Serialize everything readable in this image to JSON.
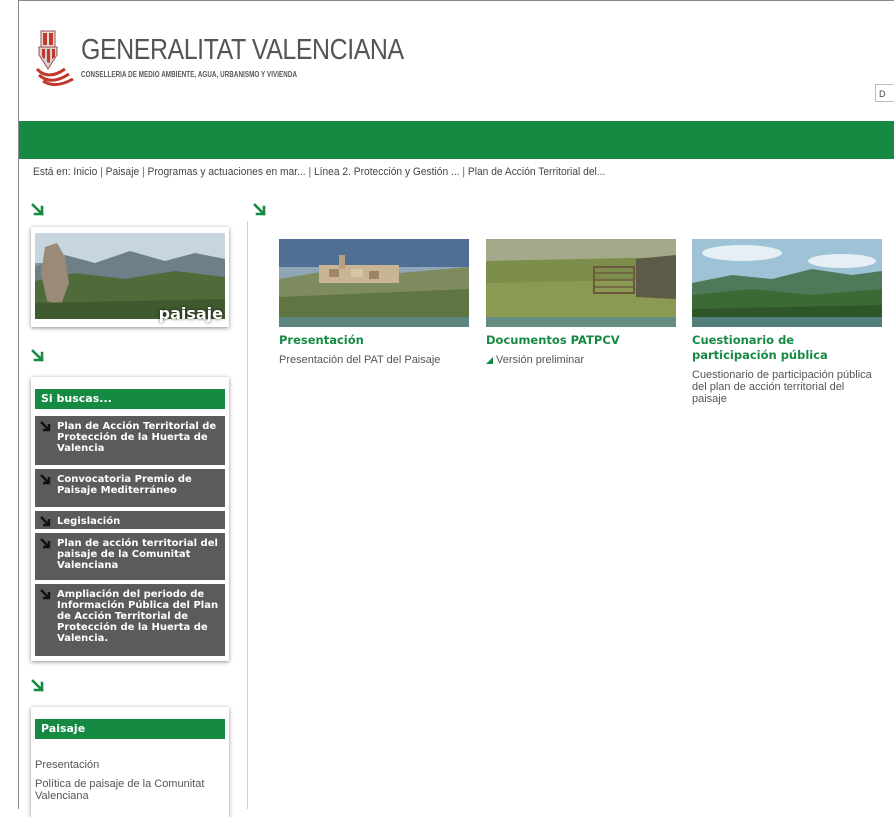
{
  "header": {
    "org_name": "GENERALITAT VALENCIANA",
    "org_subtitle": "CONSELLERIA DE MEDIO AMBIENTE, AGUA, URBANISMO Y VIVIENDA",
    "lang_fragment": "D"
  },
  "breadcrumb": {
    "prefix": "Está en:",
    "items": [
      "Inicio",
      "Paisaje",
      "Programas y actuaciones en mar...",
      "Línea 2. Protección y Gestión ...",
      "Plan de Acción Territorial del..."
    ],
    "separator": "|"
  },
  "sidebar": {
    "paisaje_label": "paisaje",
    "si_buscas": {
      "title": "Si buscas...",
      "items": [
        {
          "label": "Plan de Acción Territorial de Protección de la Huerta de Valencia"
        },
        {
          "label": "Convocatoria Premio de Paisaje Mediterráneo"
        },
        {
          "label": "Legislación"
        },
        {
          "label": "Plan de acción territorial del paisaje de la Comunitat Valenciana"
        },
        {
          "label": "Ampliación del periodo de Información Pública del Plan de Acción Territorial de Protección de la Huerta de Valencia."
        }
      ]
    },
    "paisaje_menu": {
      "title": "Paisaje",
      "items": [
        {
          "label": "Presentación"
        },
        {
          "label": "Política de paisaje de la Comunitat Valenciana"
        }
      ]
    }
  },
  "main": {
    "tiles": [
      {
        "title": "Presentación",
        "desc": "Presentación del PAT del Paisaje"
      },
      {
        "title": "Documentos PATPCV",
        "link": "Versión preliminar"
      },
      {
        "title": "Cuestionario de participación pública",
        "desc": "Cuestionario de participación pública del plan de acción territorial del paisaje"
      }
    ]
  },
  "colors": {
    "brand_green": "#168a43",
    "button_gray": "#5b5b5b"
  },
  "icons": [
    "coat-of-arms-logo",
    "green-arrow-icon",
    "dark-arrow-icon",
    "triangle-bullet-icon"
  ]
}
